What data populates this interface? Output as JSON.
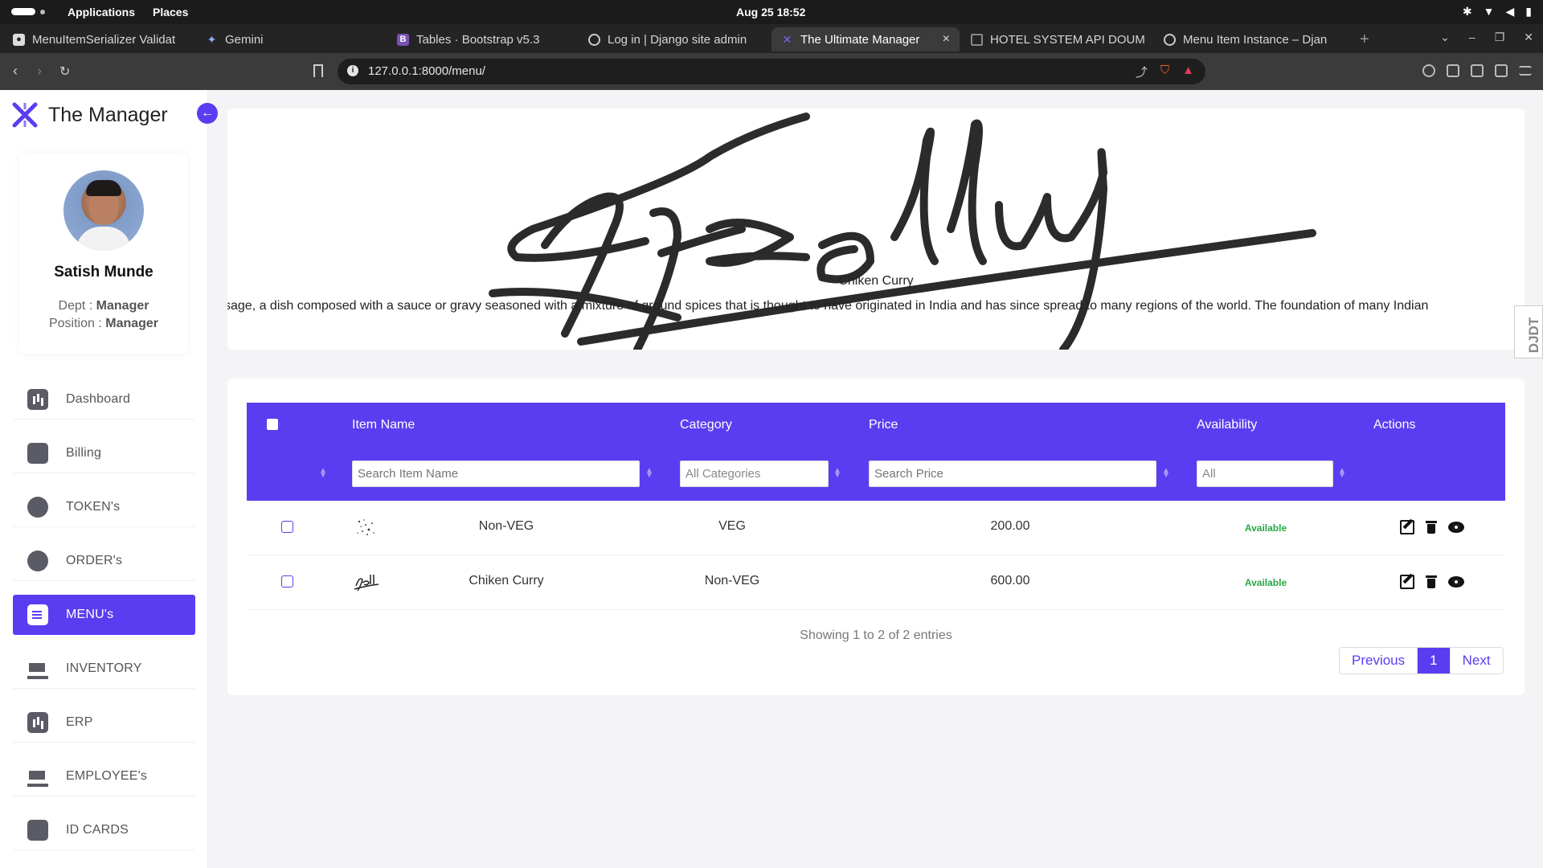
{
  "system": {
    "applications": "Applications",
    "places": "Places",
    "clock": "Aug 25  18:52"
  },
  "browser": {
    "tabs": [
      {
        "title": "MenuItemSerializer Validat",
        "favicon": "github-icon",
        "color": "#ffffff"
      },
      {
        "title": "Gemini",
        "favicon": "gemini-icon",
        "color": "#8ab4f8"
      },
      {
        "title": "Tables · Bootstrap v5.3",
        "favicon": "bootstrap-icon",
        "color": "#7952b3"
      },
      {
        "title": "Log in | Django site admin",
        "favicon": "globe-icon",
        "color": "#cccccc"
      },
      {
        "title": "The Ultimate Manager",
        "favicon": "manager-logo-icon",
        "color": "#7b61ff"
      },
      {
        "title": "HOTEL SYSTEM API DOUMI",
        "favicon": "doc-icon",
        "color": "#888888"
      },
      {
        "title": "Menu Item Instance – Djan",
        "favicon": "globe-icon",
        "color": "#cccccc"
      }
    ],
    "url": "127.0.0.1:8000/menu/"
  },
  "sidebar": {
    "brand": "The Manager",
    "profile": {
      "name": "Satish Munde",
      "dept_label": "Dept :",
      "dept_value": "Manager",
      "position_label": "Position :",
      "position_value": "Manager"
    },
    "items": [
      {
        "label": "Dashboard",
        "icon": "bar-chart-icon"
      },
      {
        "label": "Billing",
        "icon": "wallet-icon"
      },
      {
        "label": "TOKEN's",
        "icon": "badge-icon"
      },
      {
        "label": "ORDER's",
        "icon": "search-icon"
      },
      {
        "label": "MENU's",
        "icon": "menu-list-icon"
      },
      {
        "label": "INVENTORY",
        "icon": "cart-icon"
      },
      {
        "label": "ERP",
        "icon": "bar-chart-icon"
      },
      {
        "label": "EMPLOYEE's",
        "icon": "cart-icon"
      },
      {
        "label": "ID CARDS",
        "icon": "key-icon"
      }
    ]
  },
  "hero": {
    "title": "Chiken Curry",
    "description": "sage, a dish composed with a sauce or gravy seasoned with a mixture of ground spices that is thought to have originated in India and has since spread to many regions of the world. The foundation of many Indian"
  },
  "table": {
    "headers": [
      "Item Name",
      "Category",
      "Price",
      "Availability",
      "Actions"
    ],
    "filters": {
      "item_name_placeholder": "Search Item Name",
      "category_value": "All Categories",
      "price_placeholder": "Search Price",
      "availability_value": "All"
    },
    "rows": [
      {
        "item_name": "Non-VEG",
        "category": "VEG",
        "price": "200.00",
        "availability": "Available"
      },
      {
        "item_name": "Chiken Curry",
        "category": "Non-VEG",
        "price": "600.00",
        "availability": "Available"
      }
    ],
    "info": "Showing 1 to 2 of 2 entries",
    "pagination": {
      "previous": "Previous",
      "current": "1",
      "next": "Next"
    }
  },
  "colors": {
    "accent": "#5a3df0",
    "available": "#28a745"
  },
  "djdt": "DJDT"
}
